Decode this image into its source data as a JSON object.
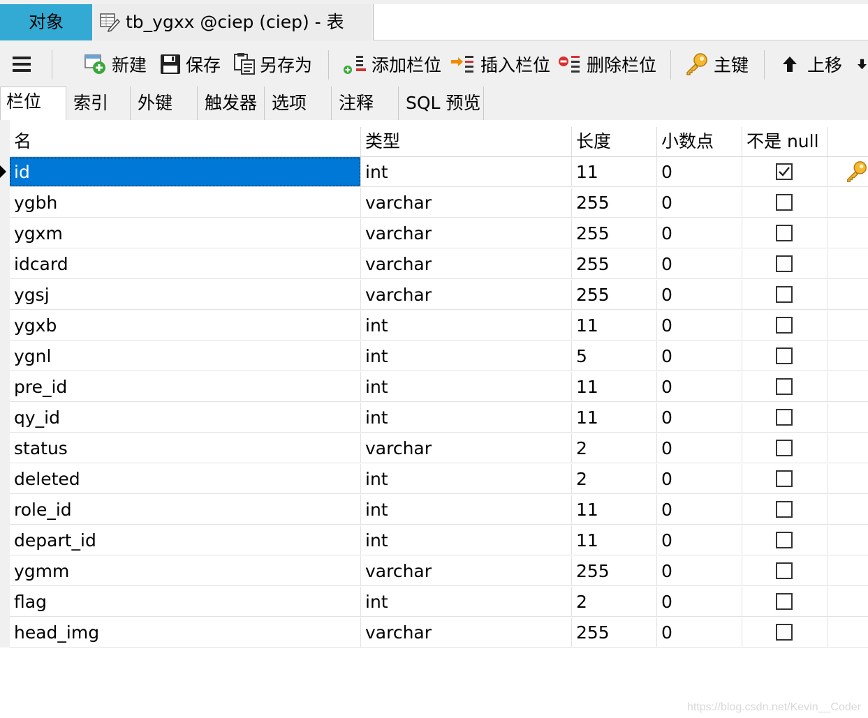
{
  "tabs": {
    "objects_label": "对象",
    "table_tab_label": "tb_ygxx @ciep (ciep) - 表"
  },
  "toolbar": {
    "new_label": "新建",
    "save_label": "保存",
    "save_as_label": "另存为",
    "add_field_label": "添加栏位",
    "insert_field_label": "插入栏位",
    "delete_field_label": "删除栏位",
    "primary_key_label": "主键",
    "move_up_label": "上移"
  },
  "subtabs": [
    "栏位",
    "索引",
    "外键",
    "触发器",
    "选项",
    "注释",
    "SQL 预览"
  ],
  "columns": {
    "name": "名",
    "type": "类型",
    "length": "长度",
    "decimals": "小数点",
    "not_null": "不是 null"
  },
  "rows": [
    {
      "name": "id",
      "type": "int",
      "length": "11",
      "decimals": "0",
      "not_null": true,
      "primary_key": true
    },
    {
      "name": "ygbh",
      "type": "varchar",
      "length": "255",
      "decimals": "0",
      "not_null": false
    },
    {
      "name": "ygxm",
      "type": "varchar",
      "length": "255",
      "decimals": "0",
      "not_null": false
    },
    {
      "name": "idcard",
      "type": "varchar",
      "length": "255",
      "decimals": "0",
      "not_null": false
    },
    {
      "name": "ygsj",
      "type": "varchar",
      "length": "255",
      "decimals": "0",
      "not_null": false
    },
    {
      "name": "ygxb",
      "type": "int",
      "length": "11",
      "decimals": "0",
      "not_null": false
    },
    {
      "name": "ygnl",
      "type": "int",
      "length": "5",
      "decimals": "0",
      "not_null": false
    },
    {
      "name": "pre_id",
      "type": "int",
      "length": "11",
      "decimals": "0",
      "not_null": false
    },
    {
      "name": "qy_id",
      "type": "int",
      "length": "11",
      "decimals": "0",
      "not_null": false
    },
    {
      "name": "status",
      "type": "varchar",
      "length": "2",
      "decimals": "0",
      "not_null": false
    },
    {
      "name": "deleted",
      "type": "int",
      "length": "2",
      "decimals": "0",
      "not_null": false
    },
    {
      "name": "role_id",
      "type": "int",
      "length": "11",
      "decimals": "0",
      "not_null": false
    },
    {
      "name": "depart_id",
      "type": "int",
      "length": "11",
      "decimals": "0",
      "not_null": false
    },
    {
      "name": "ygmm",
      "type": "varchar",
      "length": "255",
      "decimals": "0",
      "not_null": false
    },
    {
      "name": "flag",
      "type": "int",
      "length": "2",
      "decimals": "0",
      "not_null": false
    },
    {
      "name": "head_img",
      "type": "varchar",
      "length": "255",
      "decimals": "0",
      "not_null": false
    }
  ],
  "watermark": "https://blog.csdn.net/Kevin__Coder",
  "colors": {
    "selection": "#0078d7",
    "objects_tab": "#33aad4",
    "key": "#e8a317"
  },
  "icons": [
    "menu-icon",
    "new-icon",
    "save-icon",
    "save-as-icon",
    "add-field-icon",
    "insert-field-icon",
    "delete-field-icon",
    "key-icon",
    "arrow-up-icon",
    "arrow-down-icon"
  ]
}
